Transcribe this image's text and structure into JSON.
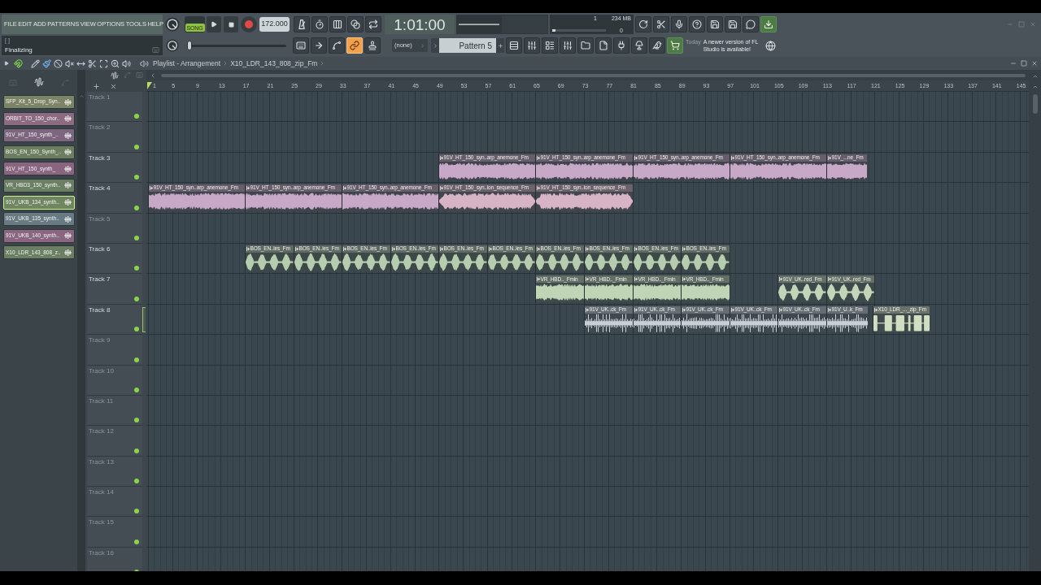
{
  "menu": [
    "FILE",
    "EDIT",
    "ADD",
    "PATTERNS",
    "VIEW",
    "OPTIONS",
    "TOOLS",
    "HELP"
  ],
  "hint_bar": {
    "brackets": "[ ]",
    "message": "Finalizing"
  },
  "transport": {
    "mode": {
      "label": "SONG",
      "selected": true
    },
    "tempo": "172.000",
    "time": "1:01:00"
  },
  "recording_buttons": [
    {
      "on": false
    },
    {
      "on": false
    },
    {
      "on": false
    },
    {
      "on": false
    },
    {
      "on": false
    }
  ],
  "snap_buttons": [
    {
      "on": false
    },
    {
      "on": false
    },
    {
      "on": false
    },
    {
      "on": true
    },
    {
      "on": false
    }
  ],
  "song_position": {
    "level": 0
  },
  "cpu_panel": {
    "voices": "1",
    "memory": "234 MB",
    "polyphony": "0"
  },
  "pattern_category": "(none)",
  "pattern": "Pattern 5",
  "news": {
    "date": "Today",
    "message": "A newer version of FL Studio is available!"
  },
  "playlist": {
    "snap": {
      "on": true
    },
    "tools": [
      {
        "selected": false
      },
      {
        "selected": true
      },
      {
        "selected": false
      },
      {
        "selected": false
      },
      {
        "selected": false
      },
      {
        "selected": false
      },
      {
        "selected": false
      },
      {
        "selected": false
      },
      {
        "selected": false
      }
    ],
    "title": "Playlist - Arrangement",
    "current_clip": "X10_LDR_143_808_zip_Fm",
    "picker": [
      {
        "label": "SFP_Kit_5_Drop_Syn..",
        "color": "#7b8464",
        "selected": false
      },
      {
        "label": "ORBIT_TO_150_chor..",
        "color": "#8c6b82",
        "selected": false
      },
      {
        "label": "91V_HT_150_synth_..",
        "color": "#7e6680",
        "selected": false
      },
      {
        "label": "BOS_EN_150_Synth_..",
        "color": "#6c7e60",
        "selected": false
      },
      {
        "label": "91V_HT_150_synth_",
        "color": "#8a6580",
        "selected": false
      },
      {
        "label": "VR_HBD3_150_synth..",
        "color": "#6b7f62",
        "selected": false
      },
      {
        "label": "91V_UKB_134_synth..",
        "color": "#6f8660",
        "selected": true
      },
      {
        "label": "91V_UKB_135_synth..",
        "color": "#687a82",
        "selected": false
      },
      {
        "label": "91V_UKB_140_synth..",
        "color": "#8a6680",
        "selected": false
      },
      {
        "label": "X10_LDR_143_808_z..",
        "color": "#6b7f62",
        "selected": false
      }
    ],
    "ruler": [
      "1",
      "5",
      "9",
      "13",
      "17",
      "21",
      "25",
      "29",
      "33",
      "37",
      "41",
      "45",
      "49",
      "53",
      "57",
      "61",
      "65",
      "69",
      "73",
      "77",
      "81",
      "85",
      "89",
      "93",
      "97",
      "101",
      "105",
      "109",
      "113",
      "117",
      "121",
      "125",
      "129",
      "133",
      "137",
      "141",
      "145"
    ],
    "tracks": [
      {
        "label": "Track 1",
        "empty": true,
        "enabled": true,
        "selected": false
      },
      {
        "label": "Track 2",
        "empty": true,
        "enabled": true,
        "selected": false
      },
      {
        "label": "Track 3",
        "empty": false,
        "enabled": true,
        "selected": false,
        "clips": [
          {
            "label": "91V_HT_150_syn..arp_anemone_Fm",
            "kind": "sustained",
            "color": "#c7a8c6"
          },
          {
            "label": "91V_HT_150_syn..arp_anemone_Fm",
            "kind": "sustained",
            "color": "#c7a8c6"
          },
          {
            "label": "91V_HT_150_syn..arp_anemone_Fm",
            "kind": "sustained",
            "color": "#c7a8c6"
          },
          {
            "label": "91V_HT_150_syn..arp_anemone_Fm",
            "kind": "sustained",
            "color": "#c7a8c6"
          },
          {
            "label": "91V_...ne_Fm",
            "kind": "sustained",
            "color": "#c7a8c6"
          }
        ]
      },
      {
        "label": "Track 4",
        "empty": false,
        "enabled": true,
        "selected": false,
        "clips": [
          {
            "label": "91V_HT_150_syn..arp_anemone_Fm",
            "kind": "sustained",
            "color": "#c7a8c6"
          },
          {
            "label": "91V_HT_150_syn..arp_anemone_Fm",
            "kind": "sustained",
            "color": "#c7a8c6"
          },
          {
            "label": "91V_HT_150_syn..arp_anemone_Fm",
            "kind": "sustained",
            "color": "#c7a8c6"
          },
          {
            "label": "91V_HT_150_syn..ion_sequence_Fm",
            "kind": "swell",
            "color": "#d7b3c6"
          },
          {
            "label": "91V_HT_150_syn..ion_sequence_Fm",
            "kind": "swell",
            "color": "#d7b3c6"
          }
        ]
      },
      {
        "label": "Track 5",
        "empty": true,
        "enabled": true,
        "selected": false
      },
      {
        "label": "Track 6",
        "empty": false,
        "enabled": true,
        "selected": false,
        "clips": [
          {
            "label": "BOS_EN..ies_Fm",
            "kind": "pulsing",
            "color": "#b6ccae"
          },
          {
            "label": "BOS_EN..ies_Fm",
            "kind": "pulsing",
            "color": "#b6ccae"
          },
          {
            "label": "BOS_EN..ies_Fm",
            "kind": "pulsing",
            "color": "#b6ccae"
          },
          {
            "label": "BOS_EN..ies_Fm",
            "kind": "pulsing",
            "color": "#b6ccae"
          },
          {
            "label": "BOS_EN..ies_Fm",
            "kind": "pulsing",
            "color": "#b6ccae"
          },
          {
            "label": "BOS_EN..ies_Fm",
            "kind": "pulsing",
            "color": "#b6ccae"
          },
          {
            "label": "BOS_EN..ies_Fm",
            "kind": "pulsing",
            "color": "#b6ccae"
          },
          {
            "label": "BOS_EN..ies_Fm",
            "kind": "pulsing",
            "color": "#b6ccae"
          },
          {
            "label": "BOS_EN..ies_Fm",
            "kind": "pulsing",
            "color": "#b6ccae"
          },
          {
            "label": "BOS_EN..ies_Fm",
            "kind": "pulsing",
            "color": "#b6ccae"
          }
        ]
      },
      {
        "label": "Track 7",
        "empty": false,
        "enabled": true,
        "selected": false,
        "clips": [
          {
            "label": "VR_HBD.._Fmin",
            "kind": "sustained",
            "color": "#c0d4b6"
          },
          {
            "label": "VR_HBD.._Fmin",
            "kind": "sustained",
            "color": "#c0d4b6"
          },
          {
            "label": "VR_HBD.._Fmin",
            "kind": "sustained",
            "color": "#c0d4b6"
          },
          {
            "label": "VR_HBD.._Fmin",
            "kind": "sustained",
            "color": "#c0d4b6"
          },
          {
            "label": "91V_UK..red_Fm",
            "kind": "pulsing",
            "color": "#c2d5b8"
          },
          {
            "label": "91V_UK..red_Fm",
            "kind": "pulsing",
            "color": "#c2d5b8"
          }
        ]
      },
      {
        "label": "Track 8",
        "empty": false,
        "enabled": true,
        "selected": true,
        "clips": [
          {
            "label": "91V_UK..ck_Fm",
            "kind": "percussive",
            "color": "#c6d0d6"
          },
          {
            "label": "91V_UK..ck_Fm",
            "kind": "percussive",
            "color": "#c6d0d6"
          },
          {
            "label": "91V_UK..ck_Fm",
            "kind": "percussive",
            "color": "#c6d0d6"
          },
          {
            "label": "91V_UK..ck_Fm",
            "kind": "percussive",
            "color": "#c6d0d6"
          },
          {
            "label": "91V_UK..ck_Fm",
            "kind": "percussive",
            "color": "#c6d0d6"
          },
          {
            "label": "91V_U..k_Fm",
            "kind": "percussive",
            "color": "#c6d0d6"
          },
          {
            "label": "X10_LDR_..._zip_Fm",
            "kind": "blocks",
            "color": "#d0dfc2"
          }
        ]
      },
      {
        "label": "Track 9",
        "empty": true,
        "enabled": true,
        "selected": false
      },
      {
        "label": "Track 10",
        "empty": true,
        "enabled": true,
        "selected": false
      },
      {
        "label": "Track 11",
        "empty": true,
        "enabled": true,
        "selected": false
      },
      {
        "label": "Track 12",
        "empty": true,
        "enabled": true,
        "selected": false
      },
      {
        "label": "Track 13",
        "empty": true,
        "enabled": true,
        "selected": false
      },
      {
        "label": "Track 14",
        "empty": true,
        "enabled": true,
        "selected": false
      },
      {
        "label": "Track 15",
        "empty": true,
        "enabled": true,
        "selected": false
      },
      {
        "label": "Track 16",
        "empty": true,
        "enabled": true,
        "selected": false
      }
    ]
  }
}
